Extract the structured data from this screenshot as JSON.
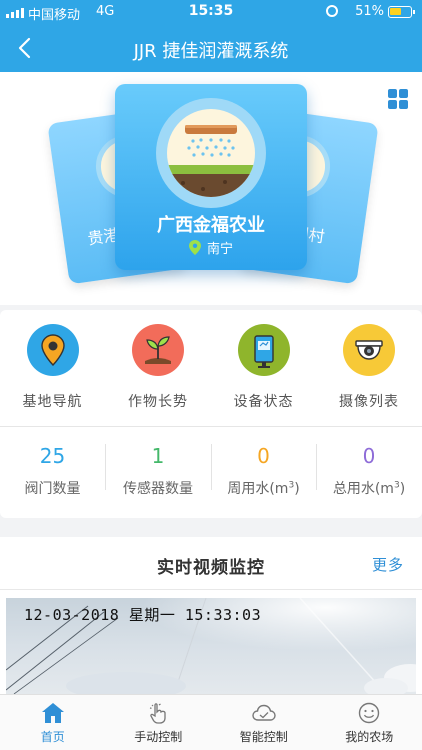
{
  "status_bar": {
    "carrier": "中国移动",
    "network": "4G",
    "time": "15:35",
    "battery": "51%"
  },
  "header": {
    "title": "JJR 捷佳润灌溉系统"
  },
  "farms": {
    "current": {
      "name": "广西金福农业",
      "location": "南宁"
    },
    "left": {
      "name_partial": "贵港"
    },
    "right": {
      "name_partial": "园村"
    }
  },
  "menu": [
    {
      "label": "基地导航",
      "icon": "map-pin-icon",
      "color": "#2fa6e6"
    },
    {
      "label": "作物长势",
      "icon": "sprout-icon",
      "color": "#f26c5a"
    },
    {
      "label": "设备状态",
      "icon": "device-icon",
      "color": "#8fb52c"
    },
    {
      "label": "摄像列表",
      "icon": "camera-icon",
      "color": "#f7c937"
    }
  ],
  "stats": [
    {
      "value": "25",
      "label": "阀门数量",
      "unit": "",
      "color": "#2fa6e6"
    },
    {
      "value": "1",
      "label": "传感器数量",
      "unit": "",
      "color": "#44b86a"
    },
    {
      "value": "0",
      "label": "周用水(m",
      "unit": "3",
      "suffix": ")",
      "color": "#f5a623"
    },
    {
      "value": "0",
      "label": "总用水(m",
      "unit": "3",
      "suffix": ")",
      "color": "#8e6cd8"
    }
  ],
  "video": {
    "title": "实时视频监控",
    "more": "更多",
    "timestamp": "12-03-2018 星期一 15:33:03"
  },
  "tabs": [
    {
      "label": "首页",
      "icon": "home-icon",
      "active": true
    },
    {
      "label": "手动控制",
      "icon": "hand-tap-icon",
      "active": false
    },
    {
      "label": "智能控制",
      "icon": "cloud-icon",
      "active": false
    },
    {
      "label": "我的农场",
      "icon": "smiley-icon",
      "active": false
    }
  ]
}
